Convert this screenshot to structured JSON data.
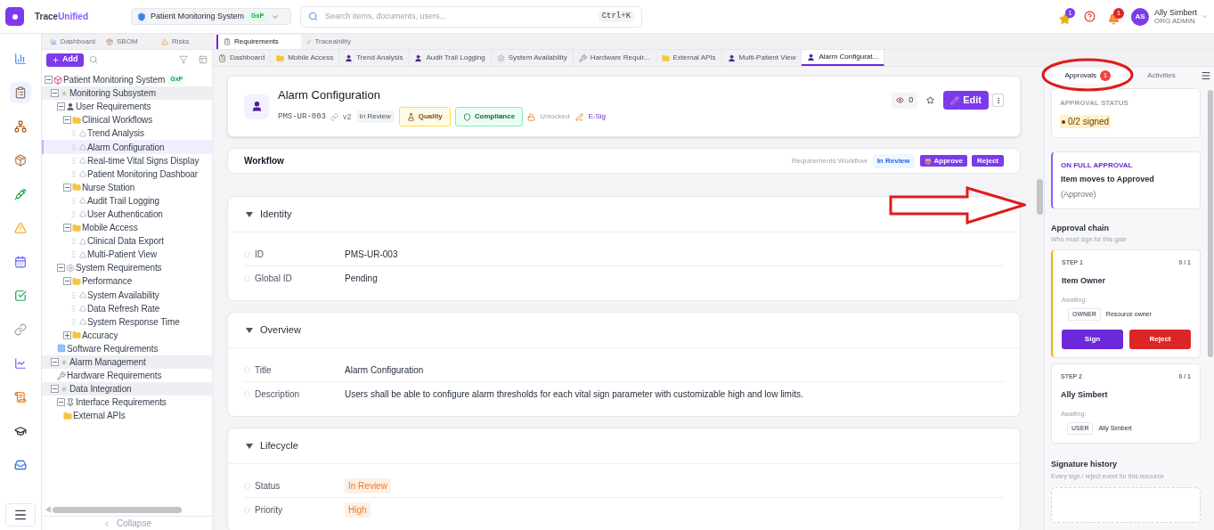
{
  "brand": {
    "first": "Trace",
    "second": "Unified"
  },
  "project": {
    "name": "Patient Monitoring System",
    "badge": "GxP"
  },
  "search": {
    "placeholder": "Search items, documents, users...",
    "shortcut": "Ctrl+K"
  },
  "header_actions": {
    "favorites_count": "1",
    "notifications_count": "1"
  },
  "user": {
    "initials": "AS",
    "name": "Ally Simbert",
    "role": "ORG ADMIN"
  },
  "rail": [
    {
      "kind": "chart",
      "selected": false
    },
    {
      "kind": "clipboard",
      "selected": true
    },
    {
      "kind": "hierarchy",
      "selected": false
    },
    {
      "kind": "package",
      "selected": false
    },
    {
      "kind": "syringe",
      "selected": false
    },
    {
      "kind": "warning",
      "selected": false
    },
    {
      "kind": "calendar",
      "selected": false
    },
    {
      "kind": "check",
      "selected": false
    },
    {
      "kind": "link",
      "selected": false
    },
    {
      "kind": "trend",
      "selected": false
    },
    {
      "kind": "scroll",
      "selected": false
    },
    {
      "kind": "cap",
      "selected": false
    },
    {
      "kind": "inbox",
      "selected": false
    }
  ],
  "module_tabs": [
    {
      "label": "Dashboard",
      "kind": "chart",
      "selected": false
    },
    {
      "label": "SBOM",
      "kind": "package",
      "selected": false
    },
    {
      "label": "Risks",
      "kind": "warning",
      "selected": false
    },
    {
      "label": "Requirements",
      "kind": "clipboard",
      "selected": true
    },
    {
      "label": "Traceability",
      "kind": "link",
      "selected": false
    }
  ],
  "tree_toolbar": {
    "add_label": "Add"
  },
  "tree": [
    {
      "label": "Patient Monitoring System",
      "badge": "GxP",
      "kind": "system",
      "expanded": true,
      "selected": false,
      "children": [
        {
          "label": "Monitoring Subsystem",
          "kind": "subsystem",
          "expanded": true,
          "selected": false,
          "children": [
            {
              "label": "User Requirements",
              "kind": "user_group",
              "expanded": true,
              "selected": false,
              "children": [
                {
                  "label": "Clinical Workflows",
                  "kind": "folder",
                  "expanded": true,
                  "selected": false,
                  "children": [
                    {
                      "label": "Trend Analysis",
                      "kind": "requirement",
                      "selected": false
                    },
                    {
                      "label": "Alarm Configuration",
                      "kind": "requirement",
                      "selected": true
                    },
                    {
                      "label": "Real-time Vital Signs Display",
                      "kind": "requirement",
                      "selected": false
                    },
                    {
                      "label": "Patient Monitoring Dashboar",
                      "kind": "requirement",
                      "selected": false
                    }
                  ]
                },
                {
                  "label": "Nurse Station",
                  "kind": "folder",
                  "expanded": true,
                  "selected": false,
                  "children": [
                    {
                      "label": "Audit Trail Logging",
                      "kind": "requirement",
                      "selected": false
                    },
                    {
                      "label": "User Authentication",
                      "kind": "requirement",
                      "selected": false
                    }
                  ]
                },
                {
                  "label": "Mobile Access",
                  "kind": "folder",
                  "expanded": true,
                  "selected": false,
                  "children": [
                    {
                      "label": "Clinical Data Export",
                      "kind": "requirement",
                      "selected": false
                    },
                    {
                      "label": "Multi-Patient View",
                      "kind": "requirement",
                      "selected": false
                    }
                  ]
                }
              ]
            },
            {
              "label": "System Requirements",
              "kind": "system_group",
              "expanded": true,
              "selected": false,
              "children": [
                {
                  "label": "Performance",
                  "kind": "folder",
                  "expanded": true,
                  "selected": false,
                  "children": [
                    {
                      "label": "System Availability",
                      "kind": "requirement",
                      "selected": false
                    },
                    {
                      "label": "Data Refresh Rate",
                      "kind": "requirement",
                      "selected": false
                    },
                    {
                      "label": "System Response Time",
                      "kind": "requirement",
                      "selected": false
                    }
                  ]
                },
                {
                  "label": "Accuracy",
                  "kind": "folder",
                  "expanded": false,
                  "selected": false
                }
              ]
            },
            {
              "label": "Software Requirements",
              "kind": "software_group",
              "selected": false
            }
          ]
        },
        {
          "label": "Alarm Management",
          "kind": "subsystem",
          "expanded": true,
          "selected": false,
          "children": [
            {
              "label": "Hardware Requirements",
              "kind": "hardware_group",
              "selected": false
            }
          ]
        },
        {
          "label": "Data Integration",
          "kind": "subsystem",
          "expanded": true,
          "selected": false,
          "children": [
            {
              "label": "Interface Requirements",
              "kind": "interface_group",
              "expanded": true,
              "selected": false,
              "children": [
                {
                  "label": "External APIs",
                  "kind": "folder",
                  "selected": false
                }
              ]
            }
          ]
        }
      ]
    }
  ],
  "tree_footer": {
    "collapse_label": "Collapse"
  },
  "doc_tabs": [
    {
      "label": "Dashboard",
      "kind": "clipboard",
      "selected": false
    },
    {
      "label": "Mobile Access",
      "kind": "folder",
      "selected": false
    },
    {
      "label": "Trend Analysis",
      "kind": "user",
      "selected": false
    },
    {
      "label": "Audit Trail Logging",
      "kind": "user",
      "selected": false
    },
    {
      "label": "System Availability",
      "kind": "gear",
      "selected": false
    },
    {
      "label": "Hardware Requir...",
      "kind": "wrench",
      "selected": false
    },
    {
      "label": "External APIs",
      "kind": "folder",
      "selected": false
    },
    {
      "label": "Multi-Patient View",
      "kind": "user",
      "selected": false
    },
    {
      "label": "Alarm Configurat...",
      "kind": "user",
      "selected": true
    }
  ],
  "item": {
    "title": "Alarm Configuration",
    "id": "PMS-UR-003",
    "version": "v2",
    "status": "In Review",
    "tags": [
      {
        "label": "Quality",
        "kind": "quality"
      },
      {
        "label": "Compliance",
        "kind": "compliance"
      }
    ],
    "lock_label": "Unlocked",
    "esig_label": "E-Sig",
    "watchers": "0",
    "edit_label": "Edit"
  },
  "workflow": {
    "title": "Workflow",
    "name": "Requirements Workflow",
    "state": "In Review",
    "approve_label": "Approve",
    "reject_label": "Reject"
  },
  "sections": [
    {
      "title": "Identity",
      "expanded": true,
      "fields": [
        {
          "label": "ID",
          "value": "PMS-UR-003",
          "kind": "text"
        },
        {
          "label": "Global ID",
          "value": "Pending",
          "kind": "text"
        }
      ]
    },
    {
      "title": "Overview",
      "expanded": true,
      "fields": [
        {
          "label": "Title",
          "value": "Alarm Configuration",
          "kind": "text"
        },
        {
          "label": "Description",
          "value": "Users shall be able to configure alarm thresholds for each vital sign parameter with customizable high and low limits.",
          "kind": "text"
        }
      ]
    },
    {
      "title": "Lifecycle",
      "expanded": true,
      "fields": [
        {
          "label": "Status",
          "value": "In Review",
          "kind": "badge"
        },
        {
          "label": "Priority",
          "value": "High",
          "kind": "badge"
        }
      ]
    }
  ],
  "side_tabs": [
    {
      "label": "Approvals",
      "count": "1",
      "selected": true
    },
    {
      "label": "Activities",
      "selected": false
    }
  ],
  "approval_status": {
    "label": "APPROVAL STATUS",
    "value": "0/2 signed"
  },
  "on_full_approval": {
    "label": "ON FULL APPROVAL",
    "text": "Item moves to Approved",
    "note": "(Approve)"
  },
  "approval_chain": {
    "title": "Approval chain",
    "subtitle": "Who must sign for this gate",
    "steps": [
      {
        "step": "STEP 1",
        "count": "0 / 1",
        "name": "Item Owner",
        "awaiting": "Awaiting:",
        "role": "OWNER",
        "role_name": "Resource owner",
        "active": true,
        "sign_label": "Sign",
        "reject_label": "Reject"
      },
      {
        "step": "STEP 2",
        "count": "0 / 1",
        "name": "Ally Simbert",
        "awaiting": "Awaiting:",
        "role": "USER",
        "role_name": "Ally Simbert",
        "active": false
      }
    ]
  },
  "signature_history": {
    "title": "Signature history",
    "subtitle": "Every sign / reject event for this resource"
  }
}
